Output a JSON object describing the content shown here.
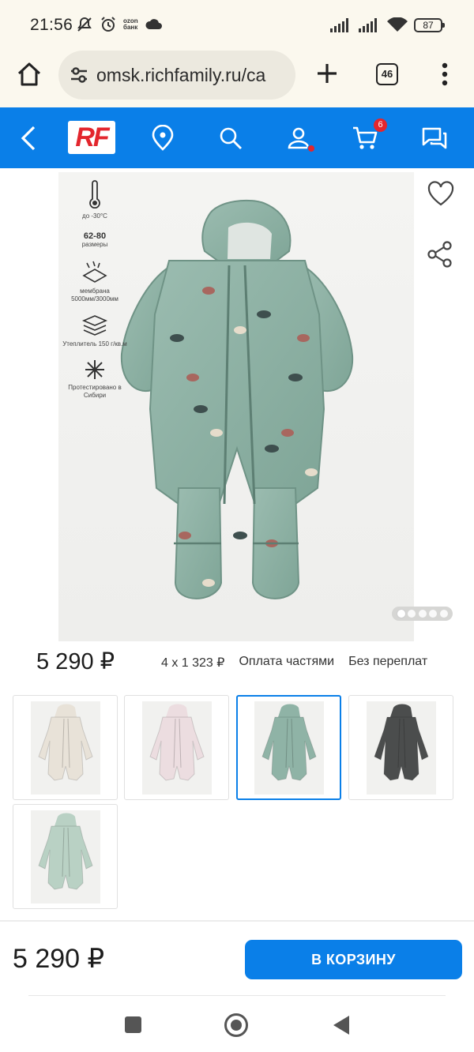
{
  "status_bar": {
    "time": "21:56",
    "ozon_line1": "ozon",
    "ozon_line2": "банк",
    "battery": "87",
    "icons": [
      "mute-icon",
      "alarm-icon",
      "ozon-bank-icon",
      "cloud-icon",
      "signal-icon",
      "signal-icon",
      "wifi-icon",
      "battery-icon"
    ]
  },
  "browser": {
    "url": "omsk.richfamily.ru/ca",
    "tabs_count": "46",
    "icons": [
      "home-icon",
      "site-settings-icon",
      "plus-icon",
      "tabs-icon",
      "menu-icon"
    ]
  },
  "site_header": {
    "logo": "RF",
    "cart_count": "6",
    "background": "#0a7fe8",
    "icons": [
      "back-icon",
      "location-icon",
      "search-icon",
      "user-icon",
      "cart-icon",
      "chat-icon"
    ]
  },
  "product": {
    "features": [
      {
        "main": "",
        "sub": "до -30°С",
        "icon": "thermometer-icon"
      },
      {
        "main": "62-80",
        "sub": "размеры",
        "icon": ""
      },
      {
        "main": "",
        "sub": "мембрана 5000мм/3000мм",
        "icon": "membrane-icon"
      },
      {
        "main": "",
        "sub": "Утеплитель 150 г/кв.м",
        "icon": "layers-icon"
      },
      {
        "main": "",
        "sub": "Протестировано в Сибири",
        "icon": "snowflake-icon"
      }
    ],
    "gallery_dots": 5,
    "active_dot": 0,
    "main_color": "#8fb3a6"
  },
  "price": {
    "main": "5 290 ₽",
    "installment": "4 x 1 323 ₽",
    "installment_label": "Оплата частями",
    "no_overpay": "Без переплат"
  },
  "variants": [
    {
      "name": "cream",
      "color": "#e8e2d8",
      "selected": false
    },
    {
      "name": "pink",
      "color": "#ecdde0",
      "selected": false
    },
    {
      "name": "sage-dino",
      "color": "#8fb3a6",
      "selected": true
    },
    {
      "name": "graphite",
      "color": "#4b4d4d",
      "selected": false
    },
    {
      "name": "mint",
      "color": "#b9d1c4",
      "selected": false
    }
  ],
  "bottom_bar": {
    "price": "5 290 ₽",
    "add_to_cart": "В КОРЗИНУ"
  }
}
